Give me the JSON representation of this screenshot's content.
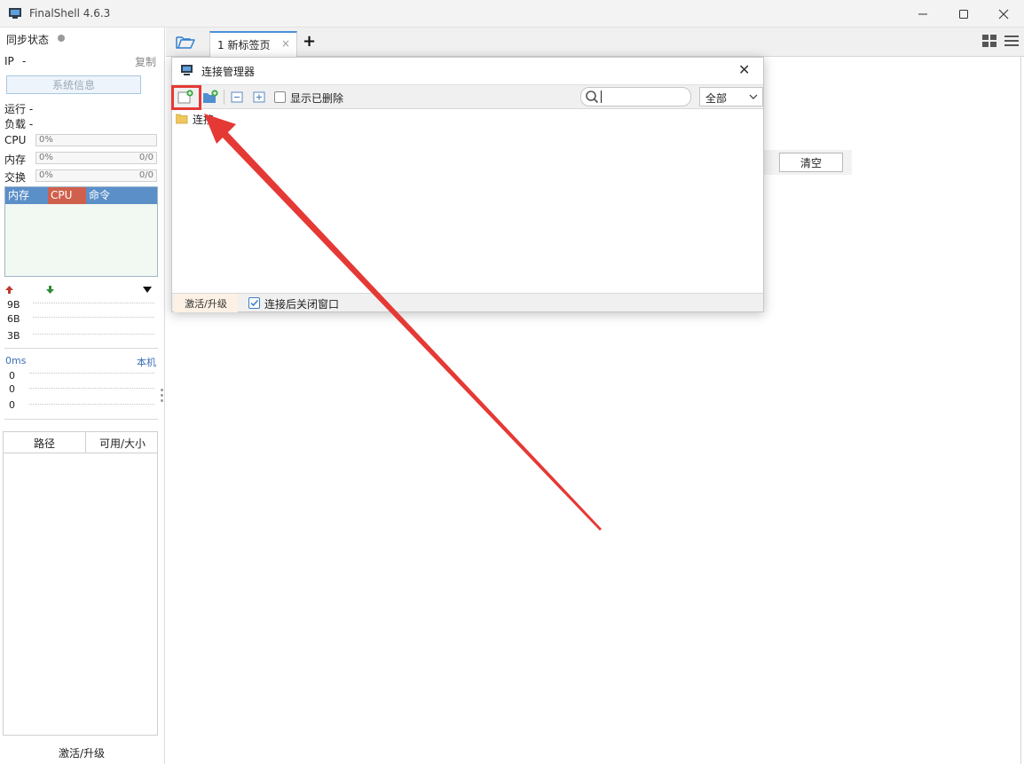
{
  "window": {
    "title": "FinalShell 4.6.3",
    "minimize_icon": "minimize-icon",
    "maximize_icon": "maximize-icon",
    "close_icon": "close-icon"
  },
  "left_panel": {
    "sync_label": "同步状态",
    "ip_label": "IP",
    "ip_value": "-",
    "copy_label": "复制",
    "sysinfo_button": "系统信息",
    "run_label": "运行 -",
    "load_label": "负载 -",
    "cpu_label": "CPU",
    "cpu_value": "0%",
    "mem_label": "内存",
    "mem_value": "0%",
    "mem_total": "0/0",
    "swap_label": "交换",
    "swap_value": "0%",
    "swap_total": "0/0",
    "proc_headers": [
      "内存",
      "CPU",
      "命令"
    ],
    "net_labels": [
      "9B",
      "6B",
      "3B"
    ],
    "ping_label": "0ms",
    "host_label": "本机",
    "ping_values": [
      "0",
      "0",
      "0"
    ],
    "disk_headers": [
      "路径",
      "可用/大小"
    ],
    "activate_label": "激活/升级"
  },
  "tabs": {
    "items": [
      {
        "label": "1 新标签页"
      }
    ],
    "close_glyph": "×",
    "add_glyph": "+"
  },
  "main": {
    "clear_button": "清空"
  },
  "dialog": {
    "title": "连接管理器",
    "close_glyph": "✕",
    "show_deleted_label": "显示已删除",
    "show_deleted_checked": false,
    "search_value": "",
    "filter_value": "全部",
    "tree_items": [
      {
        "label": "连接"
      }
    ],
    "activate_label": "激活/升级",
    "close_after_connect_label": "连接后关闭窗口",
    "close_after_connect_checked": true
  },
  "colors": {
    "accent": "#4a90d9",
    "proc_header_bg": "#5b8fc8",
    "cpu_header_bg": "#d0604c",
    "annotation_red": "#e53935"
  }
}
